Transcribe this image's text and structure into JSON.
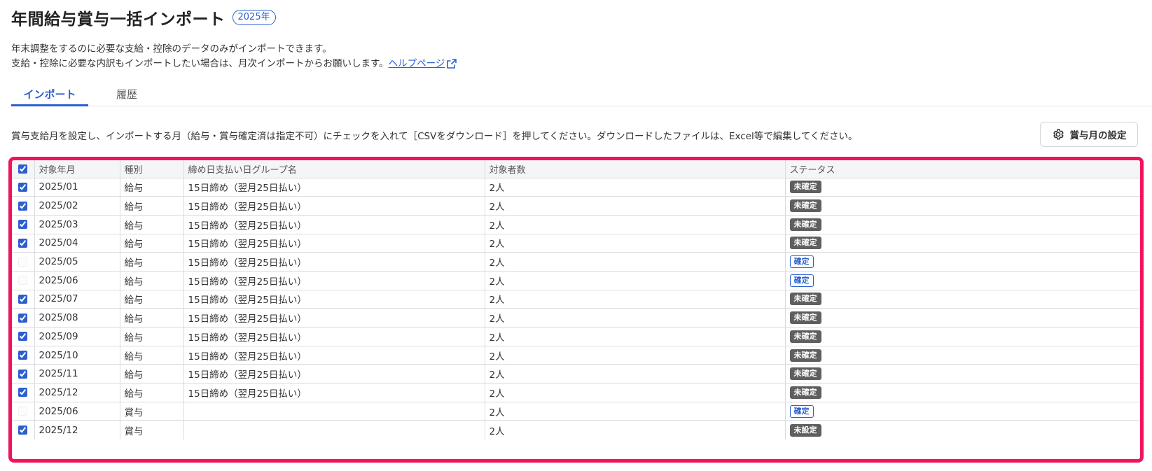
{
  "header": {
    "title": "年間給与賞与一括インポート",
    "year_badge": "2025年"
  },
  "description": {
    "line1": "年末調整をするのに必要な支給・控除のデータのみがインポートできます。",
    "line2": "支給・控除に必要な内訳もインポートしたい場合は、月次インポートからお願いします。",
    "help_link": "ヘルプページ",
    "help_icon": "external-link-icon"
  },
  "tabs": [
    {
      "label": "インポート",
      "active": true
    },
    {
      "label": "履歴",
      "active": false
    }
  ],
  "instruction": "賞与支給月を設定し、インポートする月（給与・賞与確定済は指定不可）にチェックを入れて［CSVをダウンロード］を押してください。ダウンロードしたファイルは、Excel等で編集してください。",
  "settings_button": {
    "label": "賞与月の設定",
    "icon": "gear-icon"
  },
  "colors": {
    "accent": "#2b5fd0",
    "highlight_border": "#f0145a",
    "unconfirmed_badge": "#5f5f5f"
  },
  "table": {
    "header_checked": true,
    "columns": [
      "対象年月",
      "種別",
      "締め日支払い日グループ名",
      "対象者数",
      "ステータス"
    ],
    "rows": [
      {
        "checked": true,
        "disabled": false,
        "month": "2025/01",
        "type": "給与",
        "group": "15日締め（翌月25日払い）",
        "count": "2人",
        "status": "未確定",
        "status_style": "unconfirmed"
      },
      {
        "checked": true,
        "disabled": false,
        "month": "2025/02",
        "type": "給与",
        "group": "15日締め（翌月25日払い）",
        "count": "2人",
        "status": "未確定",
        "status_style": "unconfirmed"
      },
      {
        "checked": true,
        "disabled": false,
        "month": "2025/03",
        "type": "給与",
        "group": "15日締め（翌月25日払い）",
        "count": "2人",
        "status": "未確定",
        "status_style": "unconfirmed"
      },
      {
        "checked": true,
        "disabled": false,
        "month": "2025/04",
        "type": "給与",
        "group": "15日締め（翌月25日払い）",
        "count": "2人",
        "status": "未確定",
        "status_style": "unconfirmed"
      },
      {
        "checked": false,
        "disabled": true,
        "month": "2025/05",
        "type": "給与",
        "group": "15日締め（翌月25日払い）",
        "count": "2人",
        "status": "確定",
        "status_style": "confirmed"
      },
      {
        "checked": false,
        "disabled": true,
        "month": "2025/06",
        "type": "給与",
        "group": "15日締め（翌月25日払い）",
        "count": "2人",
        "status": "確定",
        "status_style": "confirmed"
      },
      {
        "checked": true,
        "disabled": false,
        "month": "2025/07",
        "type": "給与",
        "group": "15日締め（翌月25日払い）",
        "count": "2人",
        "status": "未確定",
        "status_style": "unconfirmed"
      },
      {
        "checked": true,
        "disabled": false,
        "month": "2025/08",
        "type": "給与",
        "group": "15日締め（翌月25日払い）",
        "count": "2人",
        "status": "未確定",
        "status_style": "unconfirmed"
      },
      {
        "checked": true,
        "disabled": false,
        "month": "2025/09",
        "type": "給与",
        "group": "15日締め（翌月25日払い）",
        "count": "2人",
        "status": "未確定",
        "status_style": "unconfirmed"
      },
      {
        "checked": true,
        "disabled": false,
        "month": "2025/10",
        "type": "給与",
        "group": "15日締め（翌月25日払い）",
        "count": "2人",
        "status": "未確定",
        "status_style": "unconfirmed"
      },
      {
        "checked": true,
        "disabled": false,
        "month": "2025/11",
        "type": "給与",
        "group": "15日締め（翌月25日払い）",
        "count": "2人",
        "status": "未確定",
        "status_style": "unconfirmed"
      },
      {
        "checked": true,
        "disabled": false,
        "month": "2025/12",
        "type": "給与",
        "group": "15日締め（翌月25日払い）",
        "count": "2人",
        "status": "未確定",
        "status_style": "unconfirmed"
      },
      {
        "checked": false,
        "disabled": true,
        "month": "2025/06",
        "type": "賞与",
        "group": "",
        "count": "2人",
        "status": "確定",
        "status_style": "confirmed"
      },
      {
        "checked": true,
        "disabled": false,
        "month": "2025/12",
        "type": "賞与",
        "group": "",
        "count": "2人",
        "status": "未設定",
        "status_style": "unconfirmed"
      }
    ]
  }
}
